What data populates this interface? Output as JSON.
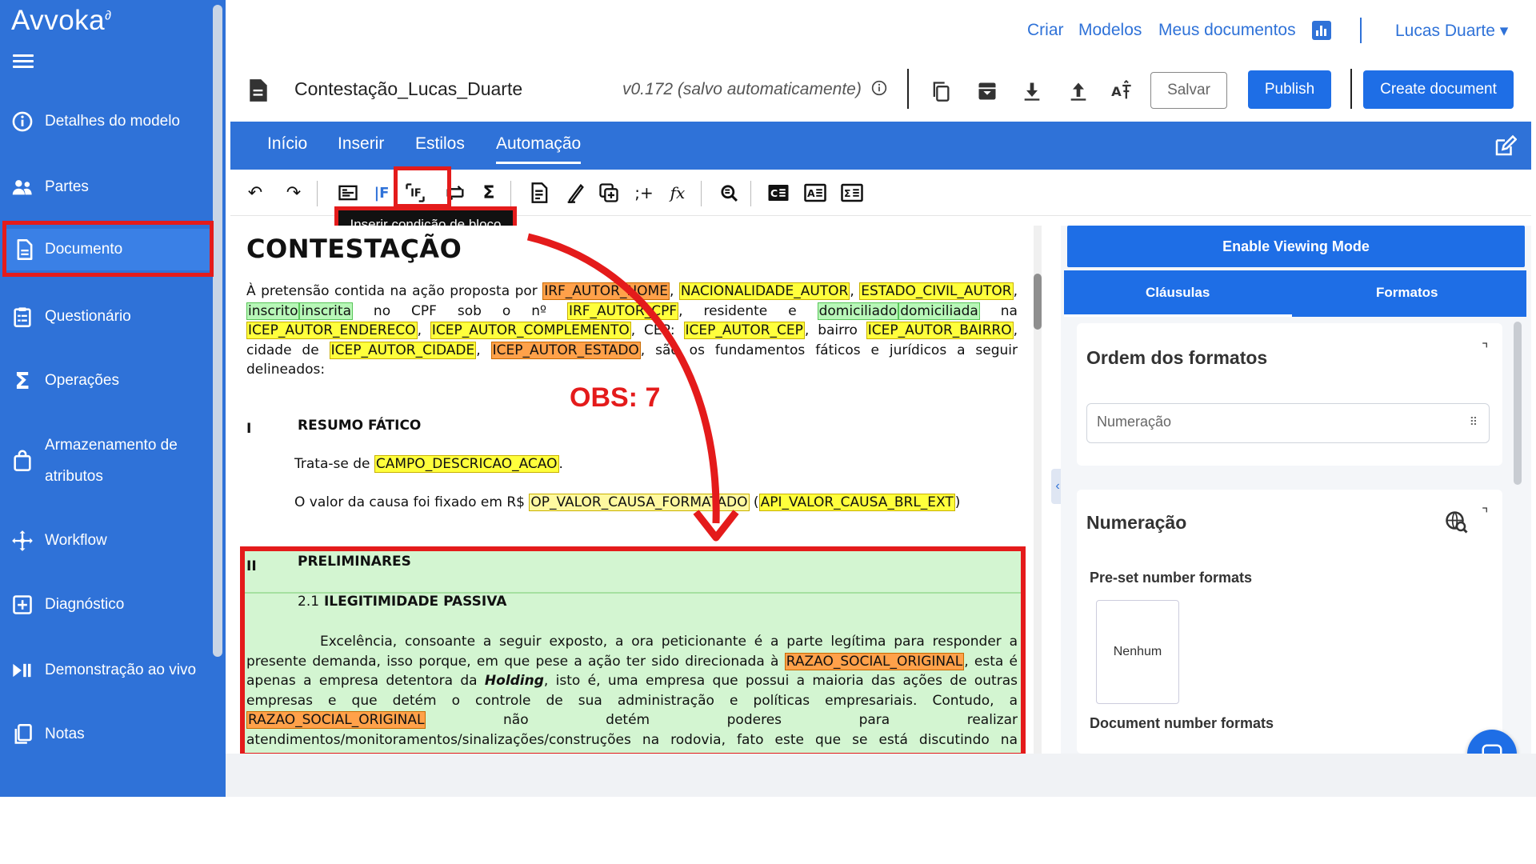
{
  "app": {
    "logo": "Avvoka",
    "logo_mark": "∂"
  },
  "sidebar": {
    "items": [
      {
        "label": "Detalhes do modelo",
        "icon": "info-icon"
      },
      {
        "label": "Partes",
        "icon": "people-icon"
      },
      {
        "label": "Documento",
        "icon": "document-icon",
        "active": true
      },
      {
        "label": "Questionário",
        "icon": "clipboard-icon"
      },
      {
        "label": "Operações",
        "icon": "sigma-icon"
      },
      {
        "label": "Armazenamento de",
        "label2": "atributos",
        "icon": "bag-icon"
      },
      {
        "label": "Workflow",
        "icon": "workflow-icon"
      },
      {
        "label": "Diagnóstico",
        "icon": "plus-box-icon"
      },
      {
        "label": "Demonstração ao vivo",
        "icon": "play-pause-icon"
      },
      {
        "label": "Notas",
        "icon": "copy-icon"
      }
    ]
  },
  "topnav": {
    "links": [
      "Criar",
      "Modelos",
      "Meus documentos"
    ],
    "user": "Lucas Duarte",
    "user_caret": "▾"
  },
  "doc_header": {
    "title": "Contestação_Lucas_Duarte",
    "version": "v0.172 (salvo automaticamente)",
    "save": "Salvar",
    "publish": "Publish",
    "create": "Create document"
  },
  "ribbon": {
    "tabs": [
      "Início",
      "Inserir",
      "Estilos",
      "Automação"
    ],
    "active_tab": "Automação"
  },
  "toolbar": {
    "tooltip": "Inserir condição de bloco",
    "tools": [
      "undo-icon",
      "redo-icon",
      "insert-field-icon",
      "if-inline-icon",
      "if-block-icon",
      "loop-icon",
      "sum-icon",
      "document-list-icon",
      "signature-icon",
      "copy-block-icon",
      "add-after-icon",
      "formula-icon",
      "find-replace-icon",
      "c-box-icon",
      "a-box-icon",
      "e-box-icon"
    ]
  },
  "document": {
    "heading": "CONTESTAÇÃO",
    "intro": {
      "t1": "À pretensão contida na ação proposta por ",
      "irf_nome": "IRF_AUTOR_NOME",
      "t2": ", ",
      "nacionalidade": "NACIONALIDADE_AUTOR",
      "t3": ", ",
      "estado_civil": "ESTADO_CIVIL_AUTOR",
      "t4": ", ",
      "inscrito": "inscrito",
      "inscrita": "inscrita",
      "t5": " no CPF sob o nº ",
      "irf_cpf": "IRF_AUTOR_CPF",
      "t6": ", residente e ",
      "domiciliado": "domiciliado",
      "domiciliada": "domiciliada",
      "t7": " na ",
      "endereco": "ICEP_AUTOR_ENDERECO",
      "t8": ", ",
      "complemento": "ICEP_AUTOR_COMPLEMENTO",
      "t9": ", CEP: ",
      "cep": "ICEP_AUTOR_CEP",
      "t10": ", bairro ",
      "bairro": "ICEP_AUTOR_BAIRRO",
      "t11": ", cidade de ",
      "cidade": "ICEP_AUTOR_CIDADE",
      "t12": ", ",
      "estado": "ICEP_AUTOR_ESTADO",
      "t13": ", são os fundamentos fáticos e jurídicos a seguir delineados:"
    },
    "sec1_num": "I",
    "sec1_title": "RESUMO FÁTICO",
    "p_descricao_t1": "Trata-se de ",
    "p_descricao_tag": "CAMPO_DESCRICAO_ACAO",
    "p_descricao_t2": ".",
    "p_valor_t1": "O valor da causa foi fixado em R$ ",
    "p_valor_tag1": "OP_VALOR_CAUSA_FORMATADO",
    "p_valor_t2": " (",
    "p_valor_tag2": "API_VALOR_CAUSA_BRL_EXT",
    "p_valor_t3": ")",
    "sec2_num": "II",
    "sec2_title": "PRELIMINARES",
    "sub_num": "2.1",
    "sub_title": "ILEGITIMIDADE PASSIVA",
    "block": {
      "t1": "Excelência, consoante a seguir exposto, a ora peticionante é a parte legítima para responder a presente demanda, isso porque, em que pese a ação ter sido direcionada à ",
      "razao1": "RAZAO_SOCIAL_ORIGINAL",
      "t2": ", esta é apenas a empresa detentora da ",
      "holding": "Holding",
      "t3": ", isto é, uma empresa que possui a maioria das ações de outras empresas e que detém o controle de sua administração e políticas empresariais. Contudo, a ",
      "razao2": "RAZAO_SOCIAL_ORIGINAL",
      "t4": " não detém poderes para realizar atendimentos/monitoramentos/sinalizações/construções na rodovia, fato este que se está discutindo na presente demanda."
    }
  },
  "annotation": {
    "obs": "OBS: 7"
  },
  "right_panel": {
    "enable_viewing": "Enable Viewing Mode",
    "tabs": [
      "Cláusulas",
      "Formatos"
    ],
    "order_title": "Ordem dos formatos",
    "order_field": "Numeração",
    "numbering_title": "Numeração",
    "preset_label": "Pre-set number formats",
    "preset_none": "Nenhum",
    "document_formats_label": "Document number formats",
    "corner_mark": "⌝"
  },
  "colors": {
    "brand": "#2f72d8",
    "button": "#1e6ee6",
    "highlight": "#e41b1b",
    "tag_yellow": "#ffff3c",
    "tag_orange": "#ffa14a",
    "tag_green": "#b8f7b8",
    "block_green": "#d3f5d1"
  }
}
